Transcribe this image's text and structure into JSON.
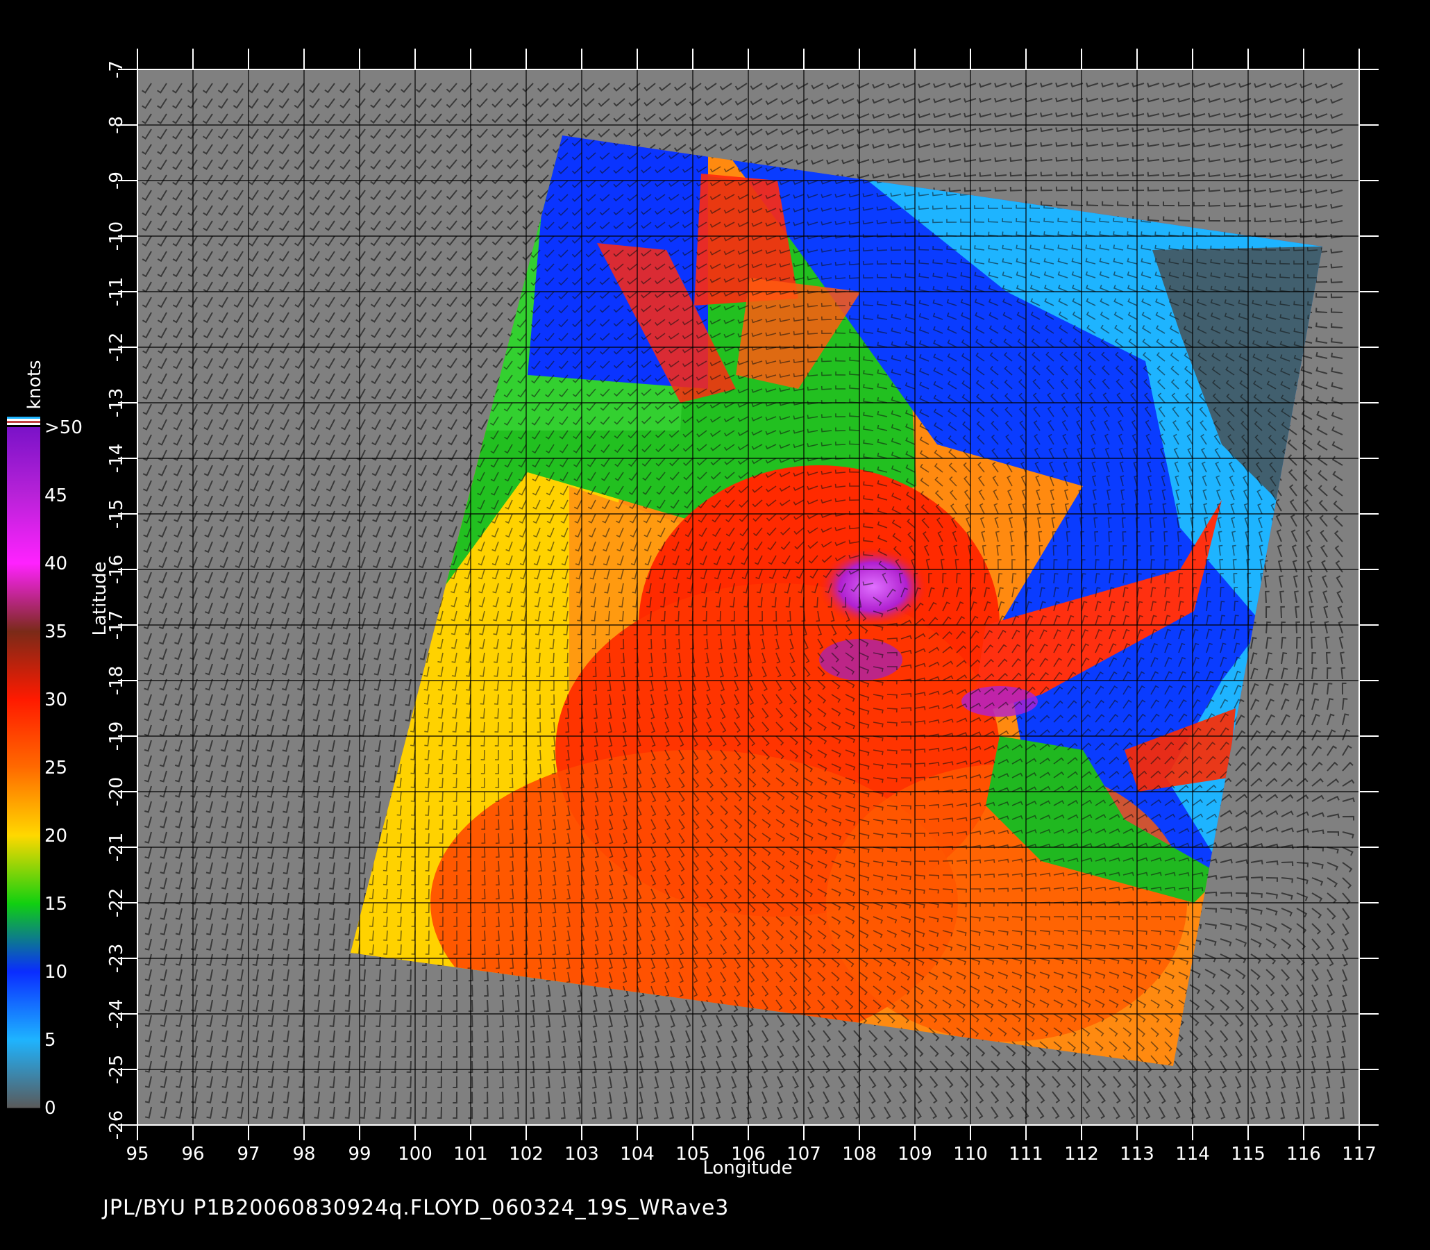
{
  "caption": "JPL/BYU  P1B20060830924q.FLOYD_060324_19S_WRave3",
  "axes": {
    "x_label": "Longitude",
    "y_label": "Latitude",
    "x_ticks": [
      "95",
      "96",
      "97",
      "98",
      "99",
      "100",
      "101",
      "102",
      "103",
      "104",
      "105",
      "106",
      "107",
      "108",
      "109",
      "110",
      "111",
      "112",
      "113",
      "114",
      "115",
      "116",
      "117"
    ],
    "y_ticks": [
      "-7",
      "-8",
      "-9",
      "-10",
      "-11",
      "-12",
      "-13",
      "-14",
      "-15",
      "-16",
      "-17",
      "-18",
      "-19",
      "-20",
      "-21",
      "-22",
      "-23",
      "-24",
      "-25",
      "-26"
    ],
    "x_range": [
      95,
      117
    ],
    "y_range": [
      -26,
      -7
    ]
  },
  "colorbar": {
    "unit": "knots",
    "labels": [
      ">50",
      "45",
      "40",
      "35",
      "30",
      "25",
      "20",
      "15",
      "10",
      "5",
      "0"
    ],
    "colors": [
      "#7a12c8",
      "#b822d8",
      "#ff22ff",
      "#7a2a18",
      "#ff1a00",
      "#ff6a00",
      "#ffd800",
      "#10d010",
      "#0a2cff",
      "#1eb4ff",
      "#5a5a5a"
    ]
  },
  "background_color": "#808080",
  "swath_center": {
    "lon": 108.3,
    "lat": -16.4
  }
}
